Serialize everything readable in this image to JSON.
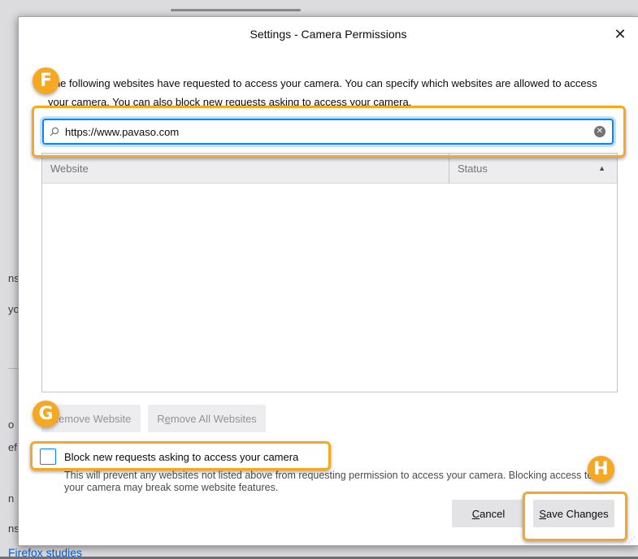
{
  "dialog": {
    "title": "Settings - Camera Permissions",
    "close_glyph": "✕",
    "description": "The following websites have requested to access your camera. You can specify which websites are allowed to access your camera. You can also block new requests asking to access your camera."
  },
  "search": {
    "value": "https://www.pavaso.com",
    "clear_glyph": "✕"
  },
  "table": {
    "columns": [
      "Website",
      "Status"
    ],
    "rows": []
  },
  "buttons": {
    "remove_website": "Remove Website",
    "remove_all_websites": "Remove All Websites",
    "cancel": "Cancel",
    "save_changes": "Save Changes"
  },
  "block": {
    "label": "Block new requests asking to access your camera",
    "note": "This will prevent any websites not listed above from requesting permission to access your camera. Blocking access to your camera may break some website features."
  },
  "callouts": {
    "f": "F",
    "g": "G",
    "h": "H"
  },
  "background": {
    "fragments": [
      "ns",
      "yo",
      "o",
      "ef",
      "n",
      "ns"
    ],
    "link": "Firefox studies"
  },
  "colors": {
    "accent": "#0a84ff",
    "callout": "#f6a823"
  }
}
